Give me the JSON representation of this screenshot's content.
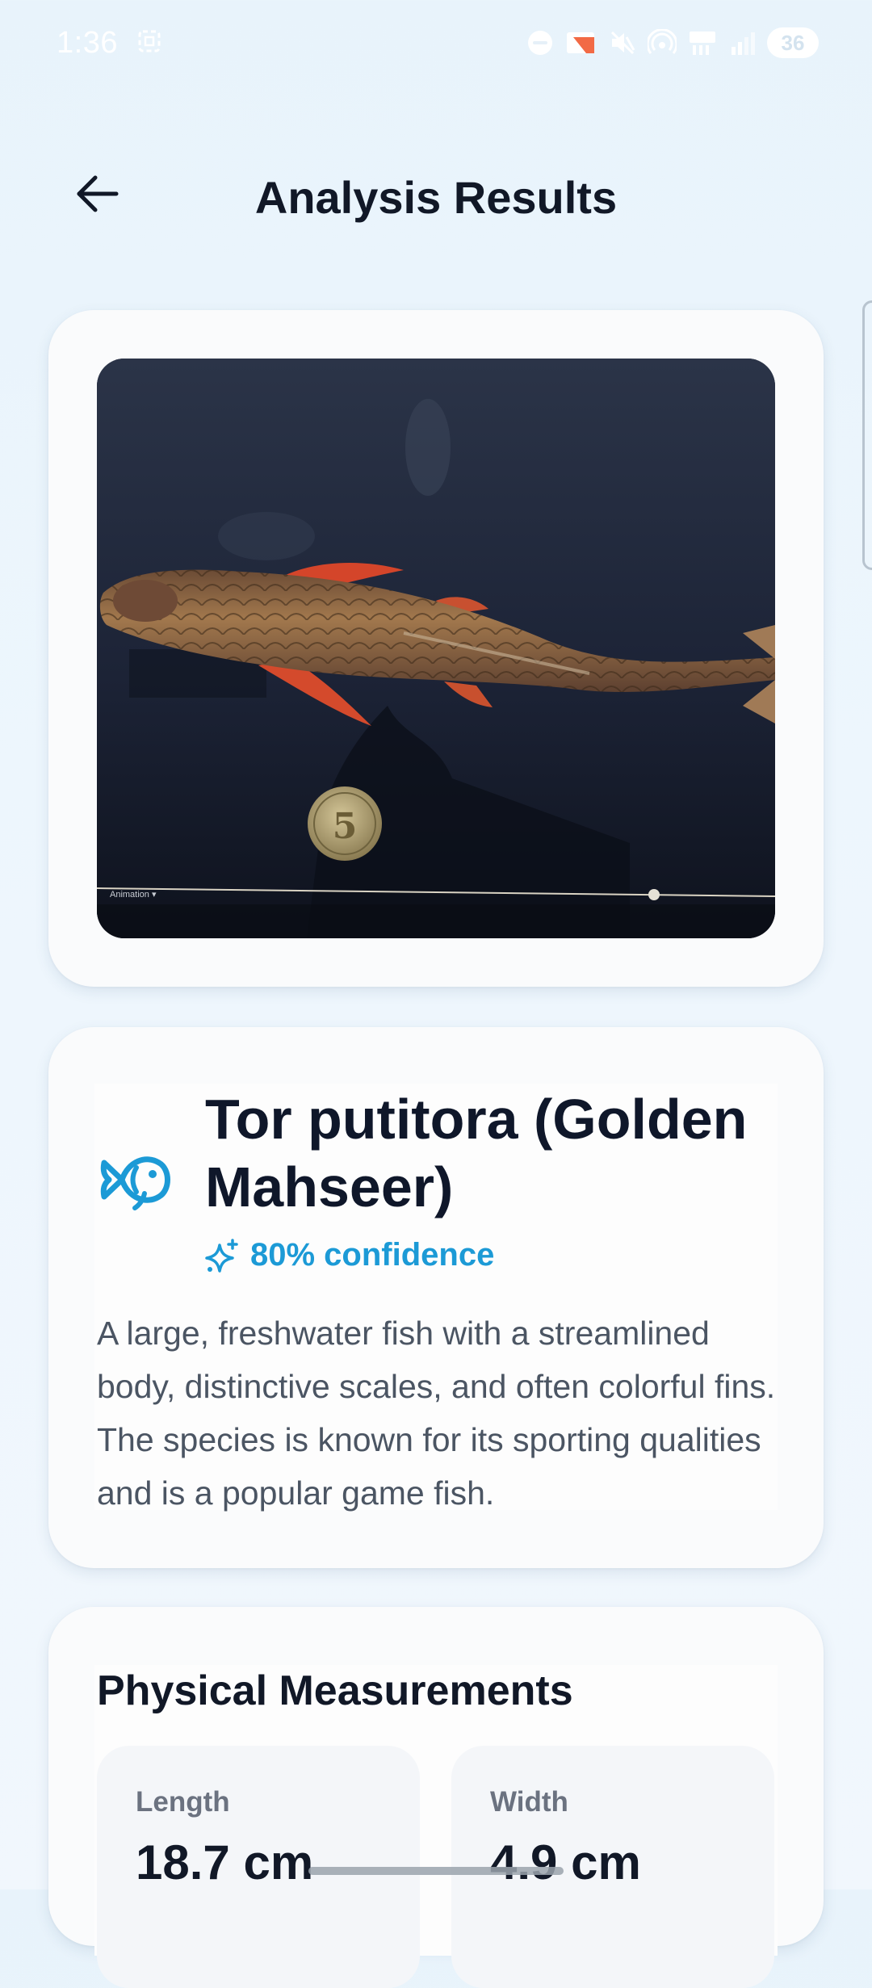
{
  "status_bar": {
    "time": "1:36",
    "battery": "36",
    "icons": [
      "screenshot-icon",
      "dnd-icon",
      "cast-icon",
      "mute-icon",
      "hotspot-icon",
      "data-icon",
      "signal-icon"
    ]
  },
  "header": {
    "title": "Analysis Results",
    "back_icon": "arrow-left-icon"
  },
  "image_card": {
    "photo_overlay_label": "Animation ▾",
    "coin_text": "5"
  },
  "species": {
    "icon": "fish-icon",
    "name": "Tor putitora (Golden Mahseer)",
    "confidence": "80% confidence",
    "confidence_icon": "sparkles-icon",
    "description": "A large, freshwater fish with a streamlined body, distinctive scales, and often colorful fins. The species is known for its sporting qualities and is a popular game fish."
  },
  "measurements": {
    "title": "Physical Measurements",
    "items": [
      {
        "label": "Length",
        "value": "18.7 cm"
      },
      {
        "label": "Width",
        "value": "4.9 cm"
      }
    ]
  },
  "colors": {
    "accent": "#1c9ad6",
    "title": "#0f172a",
    "body_text": "#4b5563",
    "background": "#eaf4fc"
  }
}
